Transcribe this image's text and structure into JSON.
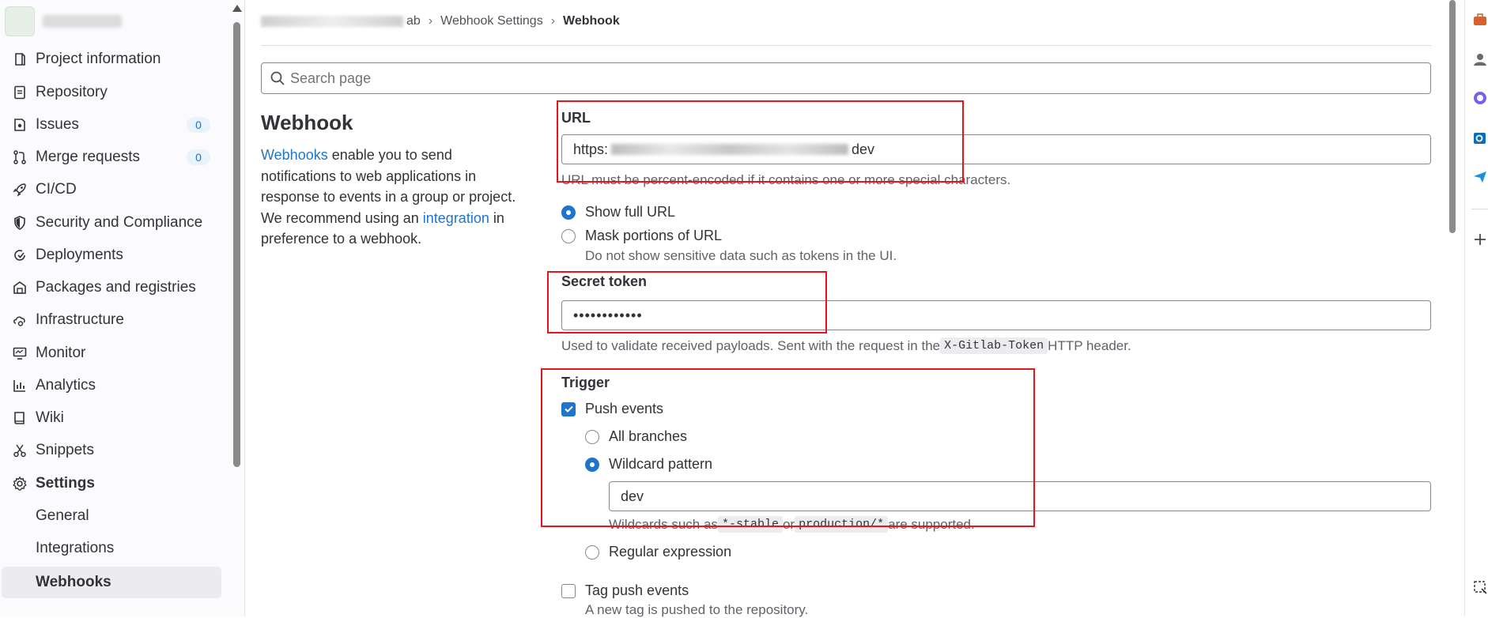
{
  "sidebar": {
    "items": [
      {
        "label": "Project information",
        "icon": "project-info-icon"
      },
      {
        "label": "Repository",
        "icon": "repository-icon"
      },
      {
        "label": "Issues",
        "icon": "issues-icon",
        "badge": "0"
      },
      {
        "label": "Merge requests",
        "icon": "merge-request-icon",
        "badge": "0"
      },
      {
        "label": "CI/CD",
        "icon": "rocket-icon"
      },
      {
        "label": "Security and Compliance",
        "icon": "shield-icon"
      },
      {
        "label": "Deployments",
        "icon": "deployments-icon"
      },
      {
        "label": "Packages and registries",
        "icon": "package-icon"
      },
      {
        "label": "Infrastructure",
        "icon": "cloud-gear-icon"
      },
      {
        "label": "Monitor",
        "icon": "monitor-icon"
      },
      {
        "label": "Analytics",
        "icon": "chart-icon"
      },
      {
        "label": "Wiki",
        "icon": "book-icon"
      },
      {
        "label": "Snippets",
        "icon": "scissors-icon"
      },
      {
        "label": "Settings",
        "icon": "gear-icon"
      }
    ],
    "settings_sub": [
      {
        "label": "General"
      },
      {
        "label": "Integrations"
      },
      {
        "label": "Webhooks",
        "active": true
      }
    ]
  },
  "breadcrumb": {
    "project_suffix": "ab",
    "middle": "Webhook Settings",
    "current": "Webhook"
  },
  "search": {
    "placeholder": "Search page"
  },
  "intro": {
    "title": "Webhook",
    "link_webhooks": "Webhooks",
    "text_1": " enable you to send notifications to web applications in response to events in a group or project. We recommend using an ",
    "link_integration": "integration",
    "text_2": " in preference to a webhook."
  },
  "url": {
    "label": "URL",
    "value_prefix": "https:",
    "value_suffix": "dev",
    "help": "URL must be percent-encoded if it contains one or more special characters.",
    "show_full": "Show full URL",
    "mask": "Mask portions of URL",
    "mask_help": "Do not show sensitive data such as tokens in the UI."
  },
  "secret": {
    "label": "Secret token",
    "value": "••••••••••••",
    "help_before": "Used to validate received payloads. Sent with the request in the ",
    "help_code": "X-Gitlab-Token",
    "help_after": " HTTP header."
  },
  "trigger": {
    "label": "Trigger",
    "push_events": "Push events",
    "all_branches": "All branches",
    "wildcard": "Wildcard pattern",
    "wildcard_value": "dev",
    "wildcard_help_1": "Wildcards such as ",
    "wildcard_code_1": "*-stable",
    "wildcard_help_2": " or ",
    "wildcard_code_2": "production/*",
    "wildcard_help_3": " are supported.",
    "regex": "Regular expression",
    "tag_push": "Tag push events",
    "tag_push_help": "A new tag is pushed to the repository."
  },
  "colors": {
    "accent": "#1f75cb",
    "highlight_box": "#e8141b",
    "sidebar_bg": "#fbfafd"
  }
}
